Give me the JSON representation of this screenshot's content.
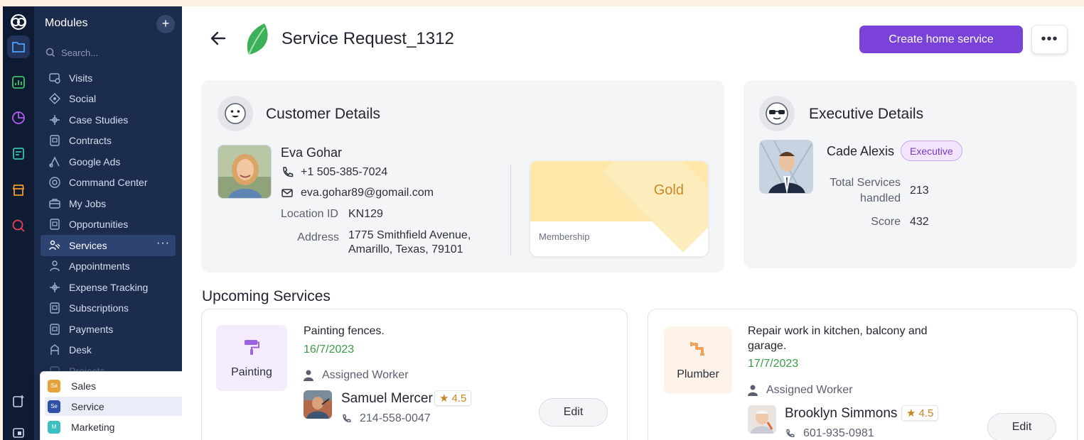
{
  "modules": {
    "title": "Modules",
    "add_label": "+",
    "search_placeholder": "Search...",
    "items": [
      {
        "label": "Visits"
      },
      {
        "label": "Social"
      },
      {
        "label": "Case Studies"
      },
      {
        "label": "Contracts"
      },
      {
        "label": "Google Ads"
      },
      {
        "label": "Command Center"
      },
      {
        "label": "My Jobs"
      },
      {
        "label": "Opportunities"
      },
      {
        "label": "Services",
        "active": true
      },
      {
        "label": "Appointments"
      },
      {
        "label": "Expense Tracking"
      },
      {
        "label": "Subscriptions"
      },
      {
        "label": "Payments"
      },
      {
        "label": "Desk"
      },
      {
        "label": "Projects"
      }
    ],
    "active_dots": "···"
  },
  "workspaces": [
    {
      "badge": "Sa",
      "label": "Sales",
      "color": "#e8a23a"
    },
    {
      "badge": "Se",
      "label": "Service",
      "color": "#2f4fa8",
      "selected": true
    },
    {
      "badge": "M",
      "label": "Marketing",
      "color": "#3bbfc0"
    }
  ],
  "header": {
    "title": "Service Request_1312",
    "primary_button": "Create home service",
    "more_label": "•••"
  },
  "customer": {
    "section_title": "Customer Details",
    "name": "Eva Gohar",
    "phone": "+1 505-385-7024",
    "email": "eva.gohar89@gomail.com",
    "location_label": "Location ID",
    "location_value": "KN129",
    "address_label": "Address",
    "address_line1": "1775 Smithfield Avenue,",
    "address_line2": "Amarillo, Texas, 79101",
    "membership_tier": "Gold",
    "membership_label": "Membership"
  },
  "executive": {
    "section_title": "Executive Details",
    "name": "Cade Alexis",
    "role_badge": "Executive",
    "services_label_1": "Total Services",
    "services_label_2": "handled",
    "services_value": "213",
    "score_label": "Score",
    "score_value": "432"
  },
  "upcoming": {
    "title": "Upcoming Services",
    "services": [
      {
        "category": "Painting",
        "title_1": "Painting fences.",
        "title_2": "",
        "date": "16/7/2023",
        "assigned_label": "Assigned Worker",
        "worker": "Samuel Mercer",
        "rating": "4.5",
        "phone": "214-558-0047",
        "edit_label": "Edit"
      },
      {
        "category": "Plumber",
        "title_1": "Repair work in kitchen, balcony and",
        "title_2": "garage.",
        "date": "17/7/2023",
        "assigned_label": "Assigned Worker",
        "worker": "Brooklyn Simmons",
        "rating": "4.5",
        "phone": "601-935-0981",
        "edit_label": "Edit"
      }
    ]
  },
  "colors": {
    "accent": "#7a42d8",
    "date_green": "#3c9a4a",
    "gold": "#c98a2b"
  }
}
